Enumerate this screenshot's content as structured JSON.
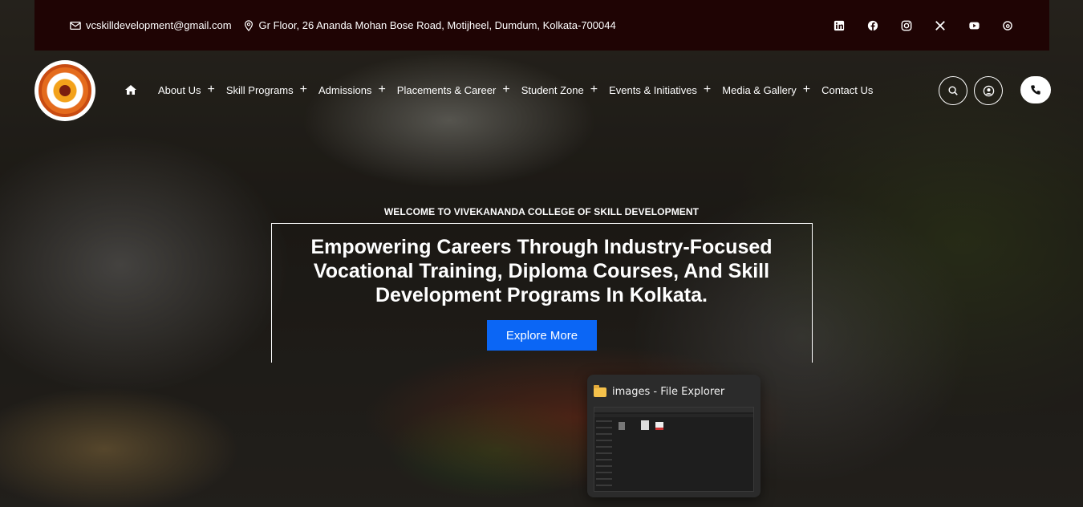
{
  "topbar": {
    "email": "vcskilldevelopment@gmail.com",
    "address": "Gr Floor, 26 Ananda Mohan Bose Road, Motijheel, Dumdum, Kolkata-700044",
    "socials": [
      "linkedin-icon",
      "facebook-icon",
      "instagram-icon",
      "x-icon",
      "youtube-icon",
      "threads-icon"
    ]
  },
  "nav": {
    "items": [
      {
        "label": "About Us",
        "has_submenu": true
      },
      {
        "label": "Skill Programs",
        "has_submenu": true
      },
      {
        "label": "Admissions",
        "has_submenu": true
      },
      {
        "label": "Placements & Career",
        "has_submenu": true
      },
      {
        "label": "Student Zone",
        "has_submenu": true
      },
      {
        "label": "Events & Initiatives",
        "has_submenu": true
      },
      {
        "label": "Media & Gallery",
        "has_submenu": true
      },
      {
        "label": "Contact Us",
        "has_submenu": false
      }
    ],
    "plus": "+"
  },
  "hero": {
    "eyebrow": "WELCOME TO VIVEKANANDA COLLEGE OF SKILL DEVELOPMENT",
    "headline": "Empowering Careers Through Industry-Focused Vocational Training, Diploma Courses, And Skill Development Programs In Kolkata.",
    "cta": "Explore More"
  },
  "taskbar_preview": {
    "title": "images - File Explorer"
  },
  "colors": {
    "topbar_bg": "#1f0404",
    "cta_bg": "#0b66f5",
    "logo_orange": "#e46b1d"
  }
}
